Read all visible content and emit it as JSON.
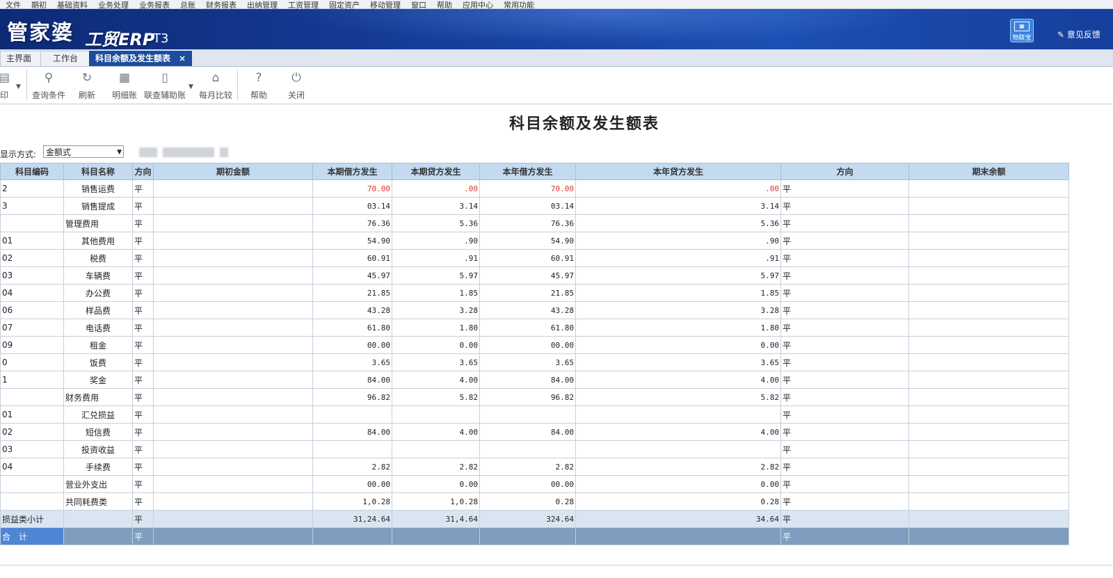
{
  "menubar": [
    "文件",
    "期初",
    "基础资料",
    "业务处理",
    "业务报表",
    "总账",
    "财务报表",
    "出纳管理",
    "工资管理",
    "固定资产",
    "移动管理",
    "窗口",
    "帮助",
    "应用中心",
    "常用功能"
  ],
  "banner": {
    "logo": "管家婆",
    "product": "工贸ERP",
    "version": "T3",
    "qr_label": "物联宝",
    "feedback": "意见反馈"
  },
  "tabs": [
    {
      "label": "主界面"
    },
    {
      "label": "工作台"
    },
    {
      "label": "科目余额及发生额表",
      "close": "×"
    }
  ],
  "toolbar": [
    {
      "label": "印",
      "icon": "print-icon"
    },
    {
      "label": "查询条件",
      "icon": "search-icon"
    },
    {
      "label": "刷新",
      "icon": "refresh-icon"
    },
    {
      "label": "明细账",
      "icon": "grid-icon"
    },
    {
      "label": "联查辅助账",
      "icon": "document-icon"
    },
    {
      "label": "每月比较",
      "icon": "home-icon"
    },
    {
      "label": "帮助",
      "icon": "help-icon"
    },
    {
      "label": "关闭",
      "icon": "power-icon"
    }
  ],
  "report_title": "科目余额及发生额表",
  "display_mode": {
    "label": "显示方式:",
    "value": "金额式"
  },
  "columns": [
    "科目编码",
    "科目名称",
    "方向",
    "期初金额",
    "本期借方发生",
    "本期贷方发生",
    "本年借方发生",
    "本年贷方发生",
    "方向",
    "期末余额"
  ],
  "rows": [
    {
      "code": "2",
      "name": "销售运费",
      "dir": "平",
      "open": "",
      "cur_debit": "70.00",
      "cur_credit": ".00",
      "year_debit": "70.00",
      "year_credit": ".00",
      "dir2": "平",
      "end": "",
      "red": true
    },
    {
      "code": "3",
      "name": "销售提成",
      "dir": "平",
      "open": "",
      "cur_debit": "03.14",
      "cur_credit": "3.14",
      "year_debit": "03.14",
      "year_credit": "3.14",
      "dir2": "平",
      "end": ""
    },
    {
      "code": "",
      "name": "管理费用",
      "dir": "平",
      "open": "",
      "cur_debit": "76.36",
      "cur_credit": "5.36",
      "year_debit": "76.36",
      "year_credit": "5.36",
      "dir2": "平",
      "end": "",
      "top": true
    },
    {
      "code": "01",
      "name": "其他费用",
      "dir": "平",
      "open": "",
      "cur_debit": "54.90",
      "cur_credit": ".90",
      "year_debit": "54.90",
      "year_credit": ".90",
      "dir2": "平",
      "end": ""
    },
    {
      "code": "02",
      "name": "税费",
      "dir": "平",
      "open": "",
      "cur_debit": "60.91",
      "cur_credit": ".91",
      "year_debit": "60.91",
      "year_credit": ".91",
      "dir2": "平",
      "end": ""
    },
    {
      "code": "03",
      "name": "车辆费",
      "dir": "平",
      "open": "",
      "cur_debit": "45.97",
      "cur_credit": "5.97",
      "year_debit": "45.97",
      "year_credit": "5.97",
      "dir2": "平",
      "end": ""
    },
    {
      "code": "04",
      "name": "办公费",
      "dir": "平",
      "open": "",
      "cur_debit": "21.85",
      "cur_credit": "1.85",
      "year_debit": "21.85",
      "year_credit": "1.85",
      "dir2": "平",
      "end": ""
    },
    {
      "code": "06",
      "name": "样品费",
      "dir": "平",
      "open": "",
      "cur_debit": "43.28",
      "cur_credit": "3.28",
      "year_debit": "43.28",
      "year_credit": "3.28",
      "dir2": "平",
      "end": ""
    },
    {
      "code": "07",
      "name": "电话费",
      "dir": "平",
      "open": "",
      "cur_debit": "61.80",
      "cur_credit": "1.80",
      "year_debit": "61.80",
      "year_credit": "1.80",
      "dir2": "平",
      "end": ""
    },
    {
      "code": "09",
      "name": "租金",
      "dir": "平",
      "open": "",
      "cur_debit": "00.00",
      "cur_credit": "0.00",
      "year_debit": "00.00",
      "year_credit": "0.00",
      "dir2": "平",
      "end": ""
    },
    {
      "code": "0",
      "name": "饭费",
      "dir": "平",
      "open": "",
      "cur_debit": "3.65",
      "cur_credit": "3.65",
      "year_debit": "3.65",
      "year_credit": "3.65",
      "dir2": "平",
      "end": ""
    },
    {
      "code": "1",
      "name": "奖金",
      "dir": "平",
      "open": "",
      "cur_debit": "84.00",
      "cur_credit": "4.00",
      "year_debit": "84.00",
      "year_credit": "4.00",
      "dir2": "平",
      "end": ""
    },
    {
      "code": "",
      "name": "财务费用",
      "dir": "平",
      "open": "",
      "cur_debit": "96.82",
      "cur_credit": "5.82",
      "year_debit": "96.82",
      "year_credit": "5.82",
      "dir2": "平",
      "end": "",
      "top": true
    },
    {
      "code": "01",
      "name": "汇兑损益",
      "dir": "平",
      "open": "",
      "cur_debit": "",
      "cur_credit": "",
      "year_debit": "",
      "year_credit": "",
      "dir2": "平",
      "end": ""
    },
    {
      "code": "02",
      "name": "短信费",
      "dir": "平",
      "open": "",
      "cur_debit": "84.00",
      "cur_credit": "4.00",
      "year_debit": "84.00",
      "year_credit": "4.00",
      "dir2": "平",
      "end": ""
    },
    {
      "code": "03",
      "name": "投资收益",
      "dir": "平",
      "open": "",
      "cur_debit": "",
      "cur_credit": "",
      "year_debit": "",
      "year_credit": "",
      "dir2": "平",
      "end": ""
    },
    {
      "code": "04",
      "name": "手续费",
      "dir": "平",
      "open": "",
      "cur_debit": "2.82",
      "cur_credit": "2.82",
      "year_debit": "2.82",
      "year_credit": "2.82",
      "dir2": "平",
      "end": ""
    },
    {
      "code": "",
      "name": "营业外支出",
      "dir": "平",
      "open": "",
      "cur_debit": "00.00",
      "cur_credit": "0.00",
      "year_debit": "00.00",
      "year_credit": "0.00",
      "dir2": "平",
      "end": "",
      "top": true
    },
    {
      "code": "",
      "name": "共同耗费类",
      "dir": "平",
      "open": "",
      "cur_debit": "1,0.28",
      "cur_credit": "1,0.28",
      "year_debit": "0.28",
      "year_credit": "0.28",
      "dir2": "平",
      "end": "",
      "top": true
    }
  ],
  "subtotal": {
    "label": "损益类小计",
    "dir": "平",
    "cur_debit": "31,24.64",
    "cur_credit": "31,4.64",
    "year_debit": "324.64",
    "year_credit": "34.64",
    "dir2": "平"
  },
  "total": {
    "label": "合　计",
    "dir": "平",
    "dir2": "平"
  }
}
